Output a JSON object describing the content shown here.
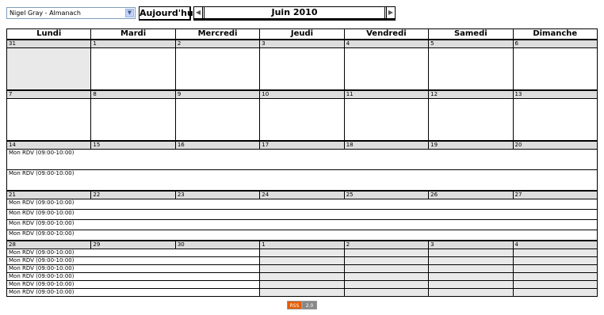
{
  "toolbar": {
    "calendar": "Nigel Gray - Almanach",
    "today": "Aujourd'hui",
    "month": "Juin 2010"
  },
  "weekdays": [
    "Lundi",
    "Mardi",
    "Mercredi",
    "Jeudi",
    "Vendredi",
    "Samedi",
    "Dimanche"
  ],
  "event_label": "Mon RDV (09:00-10:00)",
  "weeks": [
    {
      "days": [
        "31",
        "1",
        "2",
        "3",
        "4",
        "5",
        "6"
      ],
      "outside": [
        0
      ],
      "event_count": 0
    },
    {
      "days": [
        "7",
        "8",
        "9",
        "10",
        "11",
        "12",
        "13"
      ],
      "outside": [],
      "event_count": 0
    },
    {
      "days": [
        "14",
        "15",
        "16",
        "17",
        "18",
        "19",
        "20"
      ],
      "outside": [],
      "event_count": 2
    },
    {
      "days": [
        "21",
        "22",
        "23",
        "24",
        "25",
        "26",
        "27"
      ],
      "outside": [],
      "event_count": 4
    },
    {
      "days": [
        "28",
        "29",
        "30",
        "1",
        "2",
        "3",
        "4"
      ],
      "outside": [
        3,
        4,
        5,
        6
      ],
      "event_count": 6
    }
  ],
  "rss": {
    "left": "RSS",
    "right": "2.0"
  }
}
